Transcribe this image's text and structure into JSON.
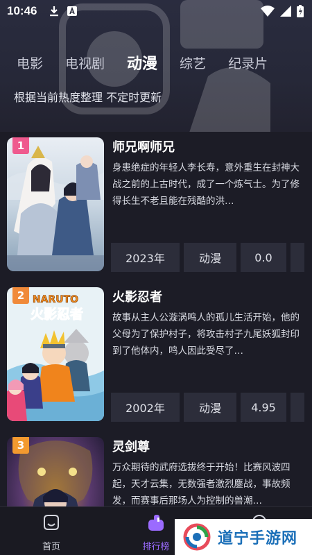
{
  "status_bar": {
    "time": "10:46"
  },
  "header": {
    "tabs": [
      {
        "label": "电影",
        "active": false
      },
      {
        "label": "电视剧",
        "active": false
      },
      {
        "label": "动漫",
        "active": true
      },
      {
        "label": "综艺",
        "active": false
      },
      {
        "label": "纪录片",
        "active": false
      }
    ],
    "subtitle": "根据当前热度整理 不定时更新"
  },
  "list": [
    {
      "rank": "1",
      "title": "师兄啊师兄",
      "description": "身患绝症的年轻人李长寿，意外重生在封神大战之前的上古时代，成了一个炼气士。为了修得长生不老且能在残酷的洪…",
      "year": "2023年",
      "genre": "动漫",
      "score": "0.0"
    },
    {
      "rank": "2",
      "title": "火影忍者",
      "description": "故事从主人公漩涡鸣人的孤儿生活开始，他的父母为了保护村子，将攻击村子九尾妖狐封印到了他体内，鸣人因此受尽了…",
      "year": "2002年",
      "genre": "动漫",
      "score": "4.95",
      "poster_text": "NARUTO 火影忍者"
    },
    {
      "rank": "3",
      "title": "灵剑尊",
      "description": "万众期待的武府选拔终于开始！比赛风波四起，天才云集，无数强者激烈鏖战，事故频发，而赛事后那场人为控制的兽潮…"
    }
  ],
  "bottom_nav": [
    {
      "label": "首页",
      "icon": "home-icon",
      "active": false
    },
    {
      "label": "排行榜",
      "icon": "ranking-icon",
      "active": true
    }
  ],
  "watermark": {
    "text": "道宁手游网"
  },
  "colors": {
    "accent": "#9b6bff",
    "rank1": "#ef5a8e",
    "rank2": "#f08a3a",
    "rank3": "#f39a2f"
  }
}
